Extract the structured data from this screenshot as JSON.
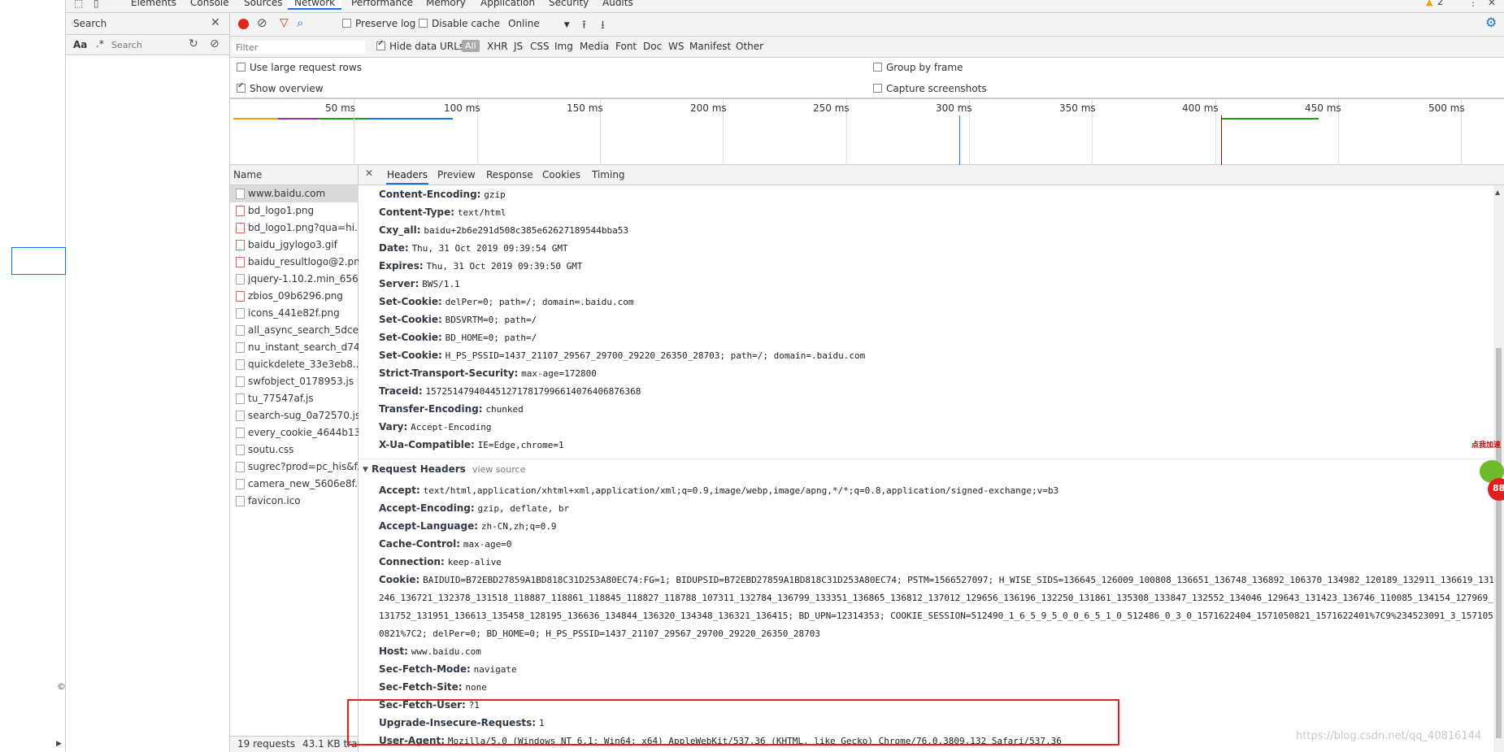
{
  "tabs": [
    "Elements",
    "Console",
    "Sources",
    "Network",
    "Performance",
    "Memory",
    "Application",
    "Security",
    "Audits"
  ],
  "warning_count": "2",
  "search_pane": {
    "title": "Search",
    "aa_label": "Aa",
    "regex_label": ".*",
    "placeholder": "Search"
  },
  "toolbar": {
    "preserve_log": "Preserve log",
    "disable_cache": "Disable cache",
    "throttle": "Online"
  },
  "filter": {
    "placeholder": "Filter",
    "hide_data_urls": "Hide data URLs",
    "types": [
      "All",
      "XHR",
      "JS",
      "CSS",
      "Img",
      "Media",
      "Font",
      "Doc",
      "WS",
      "Manifest",
      "Other"
    ]
  },
  "options": {
    "large_rows": "Use large request rows",
    "show_overview": "Show overview",
    "group_by_frame": "Group by frame",
    "capture_screenshots": "Capture screenshots"
  },
  "overview_ticks": [
    "50 ms",
    "100 ms",
    "150 ms",
    "200 ms",
    "250 ms",
    "300 ms",
    "350 ms",
    "400 ms",
    "450 ms",
    "500 ms"
  ],
  "name_header": "Name",
  "requests": [
    "www.baidu.com",
    "bd_logo1.png",
    "bd_logo1.png?qua=hi...",
    "baidu_jgylogo3.gif",
    "baidu_resultlogo@2.png",
    "jquery-1.10.2.min_656...",
    "zbios_09b6296.png",
    "icons_441e82f.png",
    "all_async_search_5dce...",
    "nu_instant_search_d74...",
    "quickdelete_33e3eb8....",
    "swfobject_0178953.js",
    "tu_77547af.js",
    "search-sug_0a72570.js",
    "every_cookie_4644b13.js",
    "soutu.css",
    "sugrec?prod=pc_his&f...",
    "camera_new_5606e8f....",
    "favicon.ico"
  ],
  "status": {
    "requests": "19 requests",
    "transferred": "43.1 KB tran"
  },
  "detail_tabs": [
    "Headers",
    "Preview",
    "Response",
    "Cookies",
    "Timing"
  ],
  "response_headers": [
    {
      "k": "Content-Encoding:",
      "v": "gzip"
    },
    {
      "k": "Content-Type:",
      "v": "text/html"
    },
    {
      "k": "Cxy_all:",
      "v": "baidu+2b6e291d508c385e62627189544bba53"
    },
    {
      "k": "Date:",
      "v": "Thu, 31 Oct 2019 09:39:54 GMT"
    },
    {
      "k": "Expires:",
      "v": "Thu, 31 Oct 2019 09:39:50 GMT"
    },
    {
      "k": "Server:",
      "v": "BWS/1.1"
    },
    {
      "k": "Set-Cookie:",
      "v": "delPer=0; path=/; domain=.baidu.com"
    },
    {
      "k": "Set-Cookie:",
      "v": "BDSVRTM=0; path=/"
    },
    {
      "k": "Set-Cookie:",
      "v": "BD_HOME=0; path=/"
    },
    {
      "k": "Set-Cookie:",
      "v": "H_PS_PSSID=1437_21107_29567_29700_29220_26350_28703; path=/; domain=.baidu.com"
    },
    {
      "k": "Strict-Transport-Security:",
      "v": "max-age=172800"
    },
    {
      "k": "Traceid:",
      "v": "1572514794044512717817996614076406876368"
    },
    {
      "k": "Transfer-Encoding:",
      "v": "chunked"
    },
    {
      "k": "Vary:",
      "v": "Accept-Encoding"
    },
    {
      "k": "X-Ua-Compatible:",
      "v": "IE=Edge,chrome=1"
    }
  ],
  "request_section": {
    "title": "Request Headers",
    "view_source": "view source"
  },
  "request_headers": [
    {
      "k": "Accept:",
      "v": "text/html,application/xhtml+xml,application/xml;q=0.9,image/webp,image/apng,*/*;q=0.8,application/signed-exchange;v=b3"
    },
    {
      "k": "Accept-Encoding:",
      "v": "gzip, deflate, br"
    },
    {
      "k": "Accept-Language:",
      "v": "zh-CN,zh;q=0.9"
    },
    {
      "k": "Cache-Control:",
      "v": "max-age=0"
    },
    {
      "k": "Connection:",
      "v": "keep-alive"
    }
  ],
  "cookie": {
    "k": "Cookie:",
    "lines": [
      "BAIDUID=B72EBD27859A1BD818C31D253A80EC74:FG=1; BIDUPSID=B72EBD27859A1BD818C31D253A80EC74; PSTM=1566527097; H_WISE_SIDS=136645_126009_100808_136651_136748_136892_106370_134982_120189_132911_136619_131",
      "246_136721_132378_131518_118887_118861_118845_118827_118788_107311_132784_136799_133351_136865_136812_137012_129656_136196_132250_131861_135308_133847_132552_134046_129643_131423_136746_110085_134154_127969_",
      "131752_131951_136613_135458_128195_136636_134844_136320_134348_136321_136415; BD_UPN=12314353; COOKIE_SESSION=512490_1_6_5_9_5_0_0_6_5_1_0_512486_0_3_0_1571622404_1571050821_1571622401%7C9%234523091_3_157105",
      "0821%7C2; delPer=0; BD_HOME=0; H_PS_PSSID=1437_21107_29567_29700_29220_26350_28703"
    ]
  },
  "request_headers_2": [
    {
      "k": "Host:",
      "v": "www.baidu.com"
    },
    {
      "k": "Sec-Fetch-Mode:",
      "v": "navigate"
    },
    {
      "k": "Sec-Fetch-Site:",
      "v": "none"
    },
    {
      "k": "Sec-Fetch-User:",
      "v": "?1"
    },
    {
      "k": "Upgrade-Insecure-Requests:",
      "v": "1"
    },
    {
      "k": "User-Agent:",
      "v": "Mozilla/5.0 (Windows NT 6.1; Win64; x64) AppleWebKit/537.36 (KHTML, like Gecko) Chrome/76.0.3809.132 Safari/537.36"
    }
  ],
  "watermark": "https://blog.csdn.net/qq_40816144",
  "badge_text": "点我加速",
  "badge_num": "88",
  "copyright_glyph": "©",
  "colors": {
    "accent": "#1a73e8",
    "record": "#e0261b",
    "highlight_box": "#e02020"
  }
}
